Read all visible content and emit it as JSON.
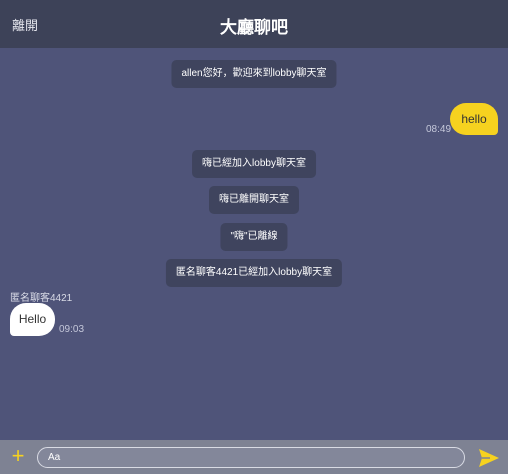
{
  "header": {
    "leave_label": "離開",
    "title": "大廳聊吧"
  },
  "messages": {
    "system": [
      "allen您好，歡迎來到lobby聊天室",
      "嗨已經加入lobby聊天室",
      "嗨已離開聊天室",
      "\"嗨\"已離線",
      "匿名聊客4421已經加入lobby聊天室"
    ],
    "mine": {
      "text": "hello",
      "time": "08:49"
    },
    "other": {
      "sender": "匿名聊客4421",
      "text": "Hello",
      "time": "09:03"
    }
  },
  "composer": {
    "plus_icon": "plus-icon",
    "placeholder": "Aa",
    "send_icon": "send-icon"
  },
  "colors": {
    "background": "#4f5479",
    "header": "#3d4258",
    "accent": "#f6d21f",
    "system_bubble": "#3f445e"
  }
}
